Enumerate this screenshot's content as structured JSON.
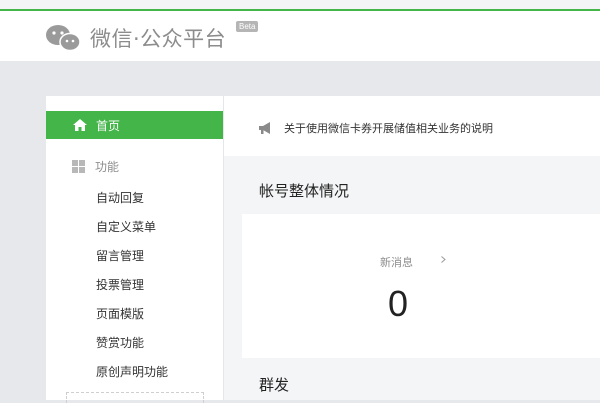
{
  "header": {
    "brand": "微信·公众平台",
    "beta": "Beta",
    "accent_color": "#44b549"
  },
  "sidebar": {
    "home_label": "首页",
    "home_icon": "home-icon",
    "function_group": "功能",
    "function_icon": "grid-icon",
    "items": [
      {
        "label": "自动回复"
      },
      {
        "label": "自定义菜单"
      },
      {
        "label": "留言管理"
      },
      {
        "label": "投票管理"
      },
      {
        "label": "页面模版"
      },
      {
        "label": "赞赏功能"
      },
      {
        "label": "原创声明功能"
      }
    ]
  },
  "main": {
    "notice": "关于使用微信卡券开展储值相关业务的说明",
    "notice_icon": "megaphone-icon",
    "account_section_title": "帐号整体情况",
    "new_messages_label": "新消息",
    "new_messages_count": "0",
    "mass_send_title": "群发"
  }
}
